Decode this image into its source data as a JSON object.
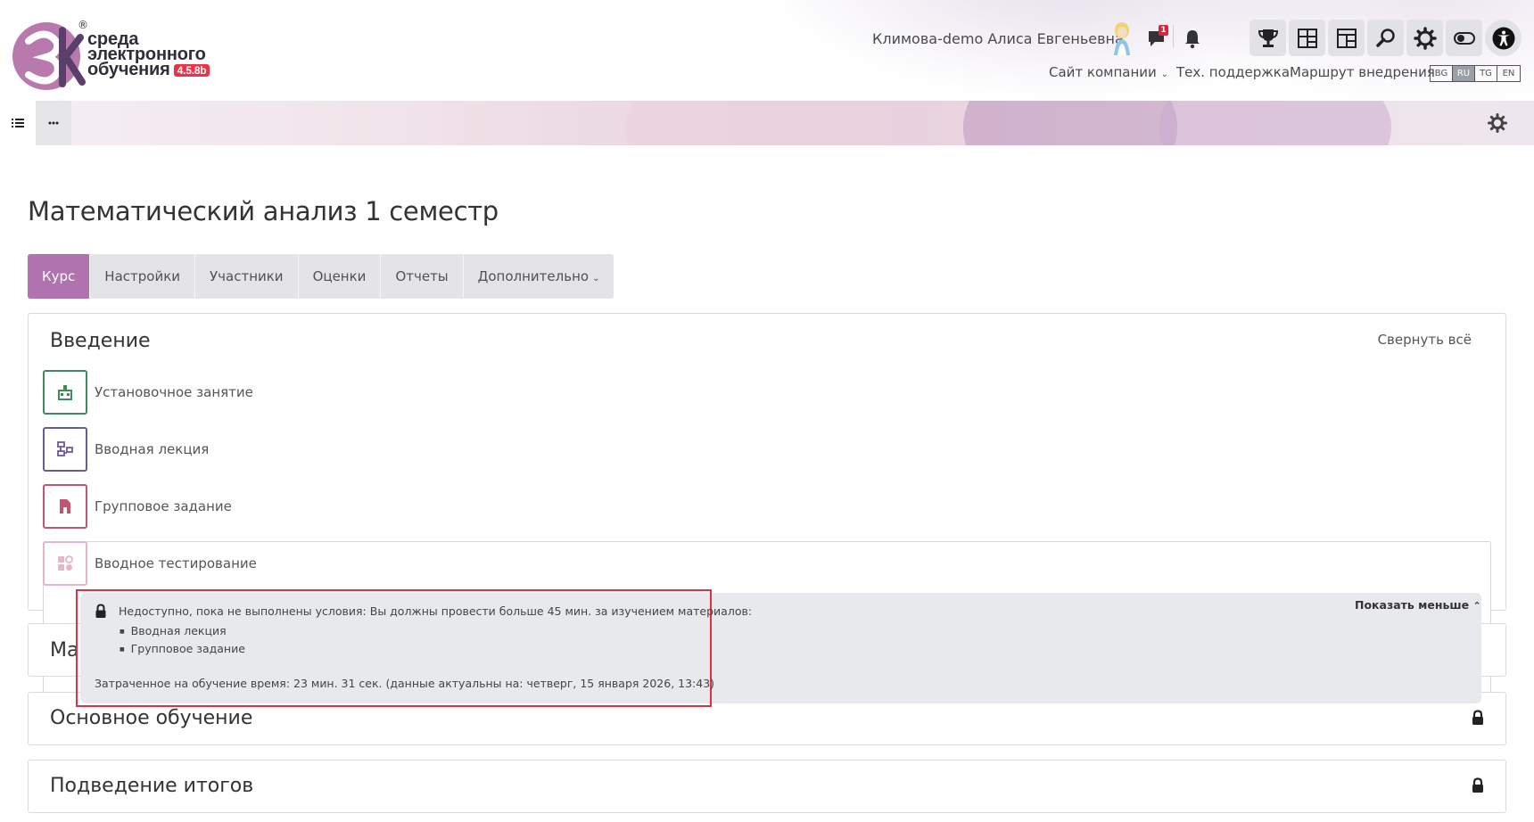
{
  "header": {
    "logo_text_line1": "среда",
    "logo_text_line2": "электронного",
    "logo_text_line3": "обучения",
    "logo_version": "4.5.8b",
    "logo_reg": "®",
    "user_name": "Климова-demo Алиса Евгеньевна",
    "message_count": "1",
    "tools": [
      "trophy-icon",
      "dashboard-icon",
      "blocks-icon",
      "search-icon",
      "gear-icon",
      "theme-toggle-icon",
      "accessibility-icon"
    ],
    "links": {
      "company_site": "Сайт компании",
      "support": "Тех. поддержка",
      "route": "Маршрут внедрения"
    },
    "languages": [
      "BG",
      "RU",
      "TG",
      "EN"
    ],
    "active_language": "RU"
  },
  "page": {
    "title": "Математический анализ 1 семестр"
  },
  "tabs": {
    "course": "Курс",
    "settings": "Настройки",
    "participants": "Участники",
    "grades": "Оценки",
    "reports": "Отчеты",
    "more": "Дополнительно"
  },
  "sections": {
    "intro": {
      "title": "Введение",
      "collapse_all": "Свернуть всё",
      "activities": [
        {
          "label": "Установочное занятие",
          "color": "#3d8c5a"
        },
        {
          "label": "Вводная лекция",
          "color": "#6a5a9a"
        },
        {
          "label": "Групповое задание",
          "color": "#c25670"
        },
        {
          "label": "Вводное тестирование",
          "color": "#e7b6c4"
        }
      ]
    },
    "hidden_section_fragment": "Ма",
    "main_learning": "Основное обучение",
    "summary": "Подведение итогов"
  },
  "restriction": {
    "message": "Недоступно, пока не выполнены условия: Вы должны провести больше 45 мин. за изучением материалов:",
    "items": [
      "Вводная лекция",
      "Групповое задание"
    ],
    "time_spent": "Затраченное на обучение время: 23 мин. 31 сек. (данные актуальны на: четверг, 15 января 2026, 13:43)",
    "show_less": "Показать меньше"
  }
}
